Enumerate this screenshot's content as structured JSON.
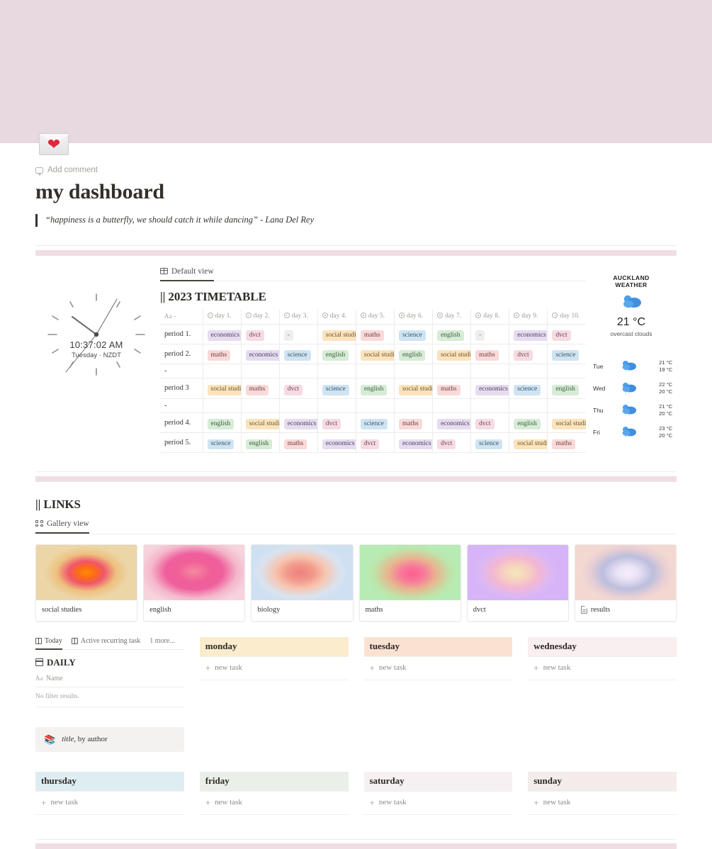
{
  "cover": {
    "icon": "envelope-with-heart-emoji"
  },
  "header": {
    "add_comment": "Add comment",
    "title": "my dashboard",
    "quote": "“happiness is a butterfly, we should catch it while dancing” - Lana Del Rey"
  },
  "clock": {
    "time": "10:37:02 AM",
    "date": "Tuesday · NZDT"
  },
  "timetable": {
    "view_tab": "Default view",
    "title": "|| 2023 TIMETABLE",
    "name_col_header": "Aa -",
    "columns": [
      "day 1.",
      "day 2.",
      "day 3.",
      "day 4.",
      "day 5.",
      "day 6.",
      "day 7.",
      "day 8.",
      "day 9.",
      "day 10."
    ],
    "rows": [
      {
        "label": "period 1.",
        "cells": [
          "economics",
          "dvct",
          "-",
          "social studies",
          "maths",
          "science",
          "english",
          "-",
          "economics",
          "dvct"
        ]
      },
      {
        "label": "period 2.",
        "cells": [
          "maths",
          "economics",
          "science",
          "english",
          "social studies",
          "english",
          "social studies",
          "maths",
          "dvct",
          "science"
        ]
      },
      {
        "label": "-",
        "cells": [
          "",
          "",
          "",
          "",
          "",
          "",
          "",
          "",
          "",
          ""
        ]
      },
      {
        "label": "period 3",
        "cells": [
          "social studies",
          "maths",
          "dvct",
          "science",
          "english",
          "social studies",
          "maths",
          "economics",
          "science",
          "english"
        ]
      },
      {
        "label": "-",
        "cells": [
          "",
          "",
          "",
          "",
          "",
          "",
          "",
          "",
          "",
          ""
        ]
      },
      {
        "label": "period 4.",
        "cells": [
          "english",
          "social studies",
          "economics",
          "dvct",
          "science",
          "maths",
          "economics",
          "dvct",
          "english",
          "social studies"
        ]
      },
      {
        "label": "period 5.",
        "cells": [
          "science",
          "english",
          "maths",
          "economics",
          "dvct",
          "economics",
          "dvct",
          "science",
          "social studies",
          "maths"
        ]
      }
    ]
  },
  "weather": {
    "city": "AUCKLAND",
    "label": "WEATHER",
    "current_temp": "21 °C",
    "description": "overcast clouds",
    "forecast": [
      {
        "day": "Tue",
        "high": "21 °C",
        "low": "19 °C"
      },
      {
        "day": "Wed",
        "high": "22 °C",
        "low": "20 °C"
      },
      {
        "day": "Thu",
        "high": "21 °C",
        "low": "20 °C"
      },
      {
        "day": "Fri",
        "high": "23 °C",
        "low": "20 °C"
      }
    ]
  },
  "links": {
    "title": "|| LINKS",
    "view_tab": "Gallery view",
    "cards": [
      {
        "label": "social studies",
        "icon": ""
      },
      {
        "label": "english",
        "icon": ""
      },
      {
        "label": "biology",
        "icon": ""
      },
      {
        "label": "maths",
        "icon": ""
      },
      {
        "label": "dvct",
        "icon": ""
      },
      {
        "label": "results",
        "icon": "document-icon"
      }
    ]
  },
  "daily": {
    "tabs": [
      "Today",
      "Active recurring task",
      "1 more..."
    ],
    "title": "DAILY",
    "name_header": "Name",
    "no_results": "No filter results.",
    "callout": {
      "title": "title",
      "rest": ", by author"
    }
  },
  "board": {
    "new_task_label": "new task",
    "days": [
      {
        "name": "monday",
        "color": "#fbeccd"
      },
      {
        "name": "tuesday",
        "color": "#fae2d3"
      },
      {
        "name": "wednesday",
        "color": "#f9eef0"
      },
      {
        "name": "thursday",
        "color": "#deedf2"
      },
      {
        "name": "friday",
        "color": "#eaf0e7"
      },
      {
        "name": "saturday",
        "color": "#f7f0f3"
      },
      {
        "name": "sunday",
        "color": "#f3ecea"
      }
    ]
  },
  "colors": {
    "cover": "#e8d8e0",
    "divider_pink": "#f0dde4"
  }
}
